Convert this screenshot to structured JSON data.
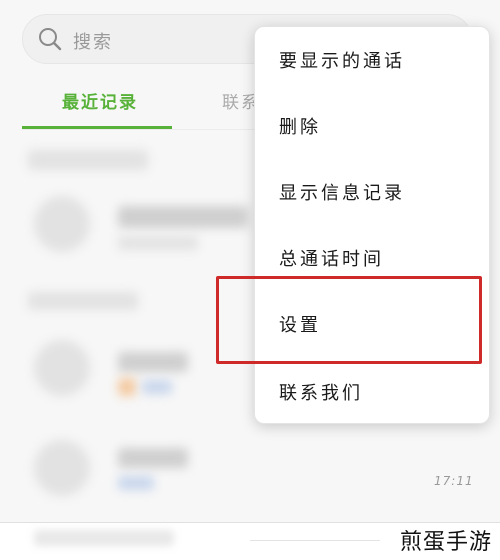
{
  "search": {
    "placeholder": "搜索"
  },
  "tabs": [
    {
      "label": "最近记录",
      "active": true
    },
    {
      "label": "联系",
      "active": false
    }
  ],
  "list": {
    "timestamp": "17:11"
  },
  "menu": {
    "items": [
      {
        "label": "要显示的通话"
      },
      {
        "label": "删除"
      },
      {
        "label": "显示信息记录"
      },
      {
        "label": "总通话时间"
      },
      {
        "label": "设置",
        "highlighted": true
      },
      {
        "label": "联系我们"
      }
    ]
  },
  "watermark": {
    "text": "煎蛋手游"
  },
  "colors": {
    "accent": "#58b23a",
    "highlight": "#cf2a2a",
    "menu_bg": "#ffffff"
  }
}
